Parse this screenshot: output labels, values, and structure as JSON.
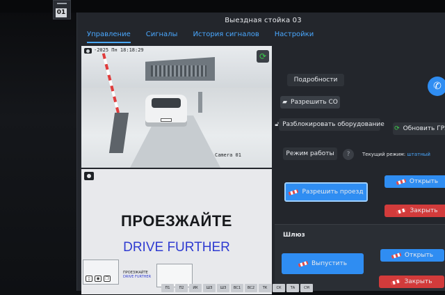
{
  "window": {
    "title": "Выездная стойка 03"
  },
  "sidebar": {
    "badge": "01"
  },
  "tabs": [
    {
      "label": "Управление",
      "active": true
    },
    {
      "label": "Сигналы"
    },
    {
      "label": "История сигналов"
    },
    {
      "label": "Настройки"
    }
  ],
  "camera": {
    "timestamp": "-2025 Пн 18:18:29",
    "name": "Camera 01",
    "refresh_icon": "refresh-icon"
  },
  "board": {
    "text_ru": "ПРОЕЗЖАЙТЕ",
    "text_en": "DRIVE FURTHER",
    "mini_ru": "ПРОЕЗЖАЙТЕ",
    "mini_en": "DRIVE FURTHER"
  },
  "controls": {
    "details": "Подробности",
    "allow_co": "Разрешить СО",
    "unlock": "Разблокировать оборудование",
    "update_grz": "Обновить ГРЗ",
    "work_mode": "Режим работы",
    "help": "?",
    "current_mode_label": "Текущий режим:",
    "current_mode_value": "штатный",
    "allow_pass": "Разрешить проезд",
    "open": "Открыть",
    "close": "Закрыть"
  },
  "gateway": {
    "title": "Шлюз",
    "release": "Выпустить",
    "open": "Открыть",
    "close": "Закрыть"
  },
  "status_chips": [
    "П1",
    "П2",
    "ИК",
    "ШЗ",
    "ШЗ",
    "ВС1",
    "ВС2",
    "ТК",
    "СК",
    "ТА",
    "СМ"
  ],
  "colors": {
    "accent": "#2f8df2",
    "danger": "#d23b3b",
    "ok": "#39c94a",
    "link": "#4aa8ff"
  }
}
